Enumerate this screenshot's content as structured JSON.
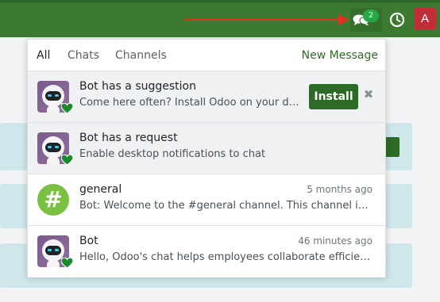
{
  "topbar": {
    "chat_counter": "2",
    "user_initial": "A",
    "accent": "#3c7a32",
    "icons": [
      "chat-icon",
      "clock-icon"
    ]
  },
  "dropdown": {
    "filters": [
      "All",
      "Chats",
      "Channels"
    ],
    "active_filter": "All",
    "new_message": "New Message",
    "items": [
      {
        "title": "Bot has a suggestion",
        "subtitle": "Come here often? Install Odoo on your de...",
        "action": "Install",
        "dismiss": "✖",
        "unread": true,
        "avatar": "bot-avatar-icon"
      },
      {
        "title": "Bot has a request",
        "subtitle": "Enable desktop notifications to chat",
        "unread": true,
        "avatar": "bot-avatar-icon"
      },
      {
        "title": "general",
        "date": "5 months ago",
        "subtitle": "Bot: Welcome to the #general channel. This channel is ...",
        "unread": false,
        "avatar": "hash-icon",
        "avatar_glyph": "#"
      },
      {
        "title": "Bot",
        "date": "46 minutes ago",
        "subtitle": "Hello, Odoo's chat helps employees collaborate efficien...",
        "unread": false,
        "avatar": "bot-avatar-icon"
      }
    ]
  }
}
